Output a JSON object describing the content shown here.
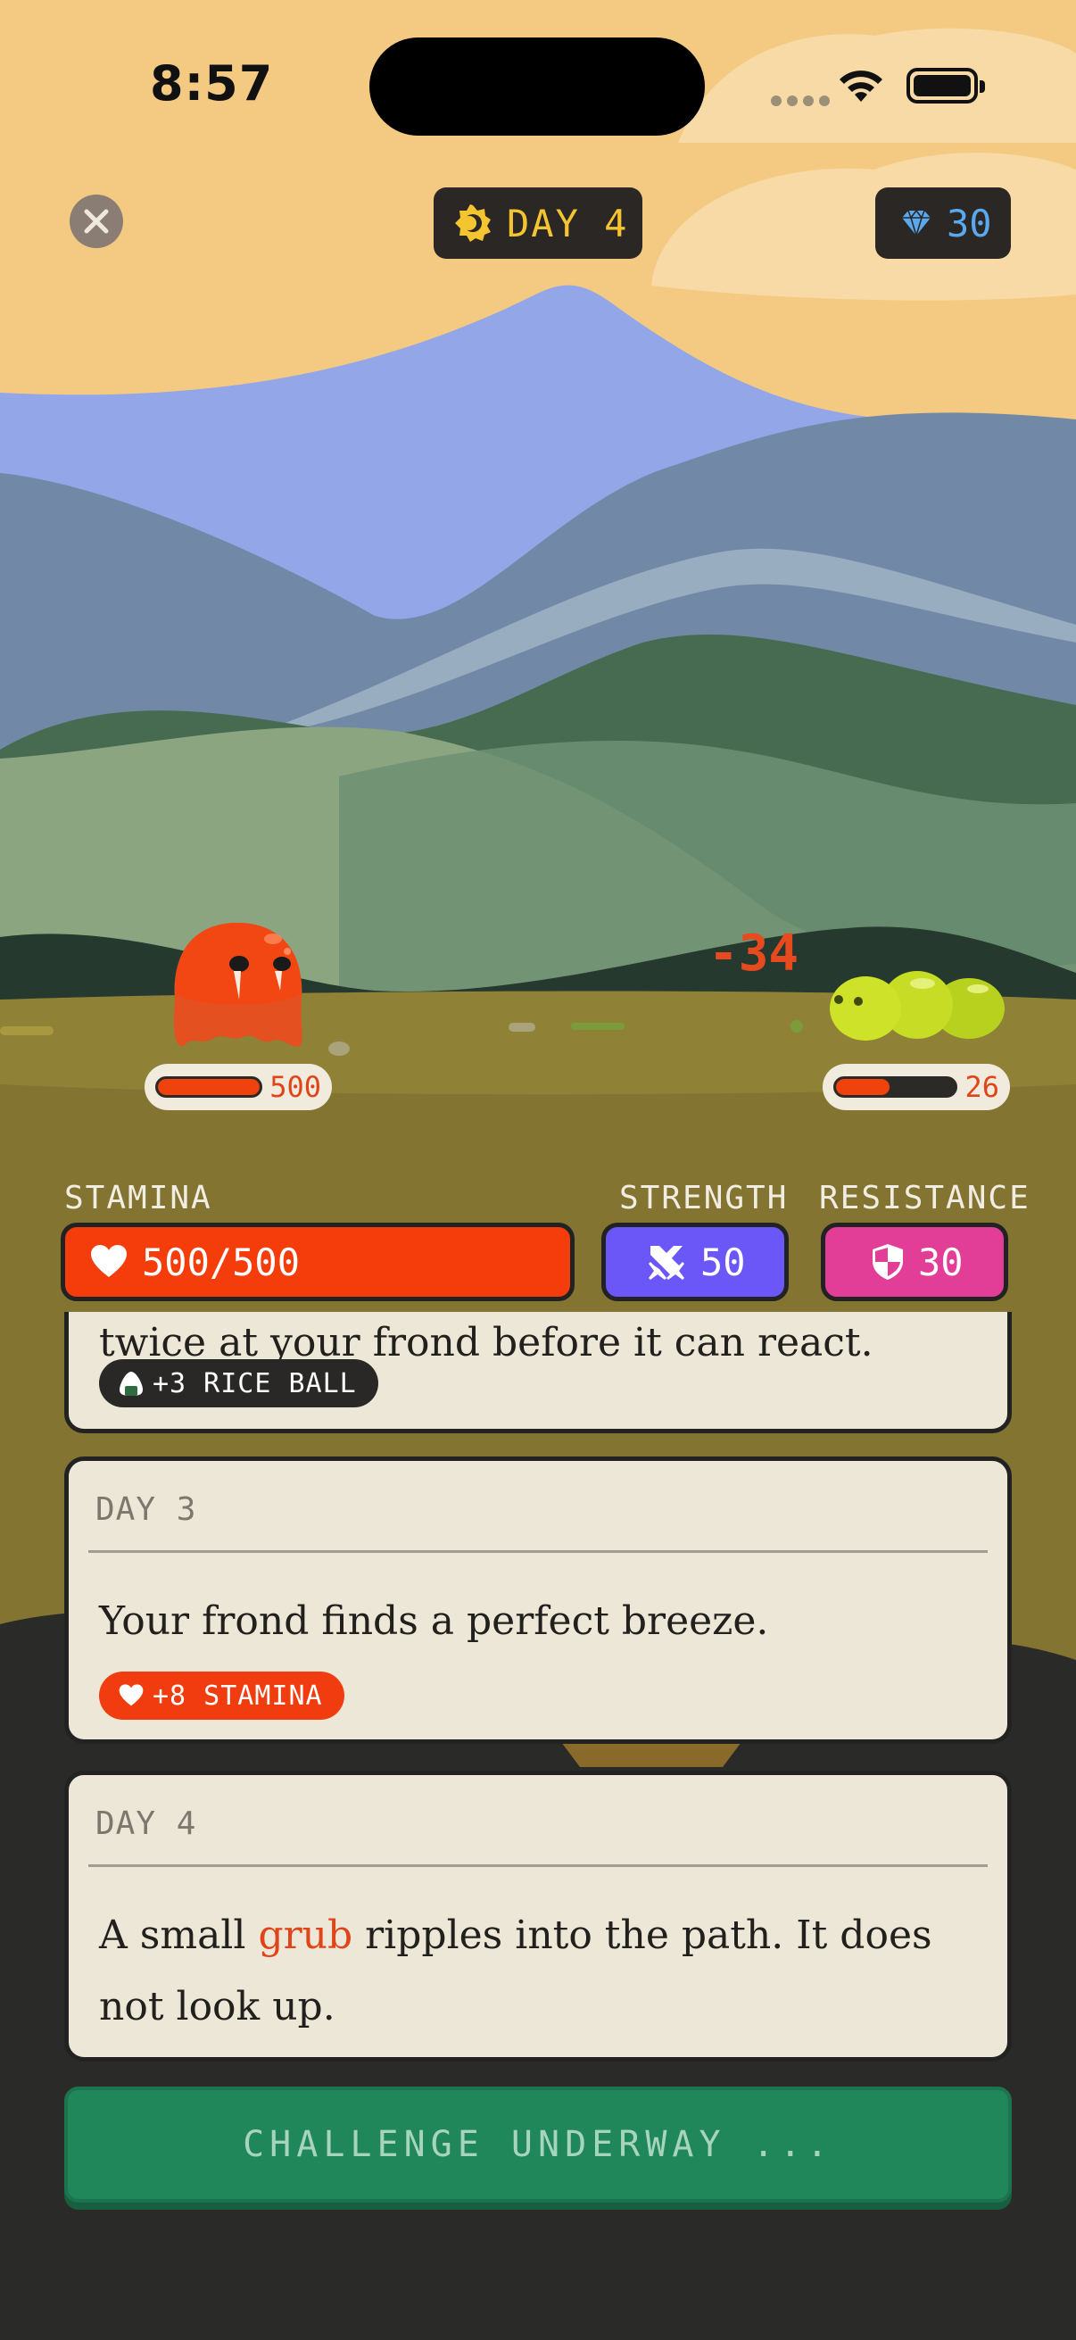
{
  "status_bar": {
    "time": "8:57"
  },
  "header": {
    "close_icon": "close-icon",
    "day_label": "DAY 4",
    "day_icon": "sun-moon-icon",
    "gems": "30",
    "gem_icon": "gem-icon"
  },
  "battle": {
    "damage_text": "-34",
    "player": {
      "hp_label": "500",
      "hp_fraction": 1.0
    },
    "enemy": {
      "hp_label": "26",
      "hp_fraction": 0.45
    }
  },
  "stats": {
    "stamina_label": "STAMINA",
    "stamina_value": "500/500",
    "strength_label": "STRENGTH",
    "strength_value": "50",
    "resistance_label": "RESISTANCE",
    "resistance_value": "30"
  },
  "log": {
    "entries": [
      {
        "day": "",
        "text": "twice at your frond before it can react.",
        "tag": "+3 RICE BALL",
        "tag_icon": "rice-ball-icon"
      },
      {
        "day": "DAY 3",
        "text": "Your frond finds a perfect breeze.",
        "tag": "+8 STAMINA",
        "tag_icon": "heart-icon"
      },
      {
        "day": "DAY 4",
        "text_before": "A small ",
        "highlight": "grub",
        "text_after": " ripples into the path. It does not look up."
      }
    ]
  },
  "cta": {
    "label": "CHALLENGE UNDERWAY ..."
  },
  "colors": {
    "sky": "#f4ca83",
    "stamina": "#f43d0b",
    "strength": "#6b57f7",
    "resistance": "#e23e97",
    "cta": "#1f875a",
    "day_gold": "#f5c431",
    "gem_blue": "#5aa9ee"
  }
}
